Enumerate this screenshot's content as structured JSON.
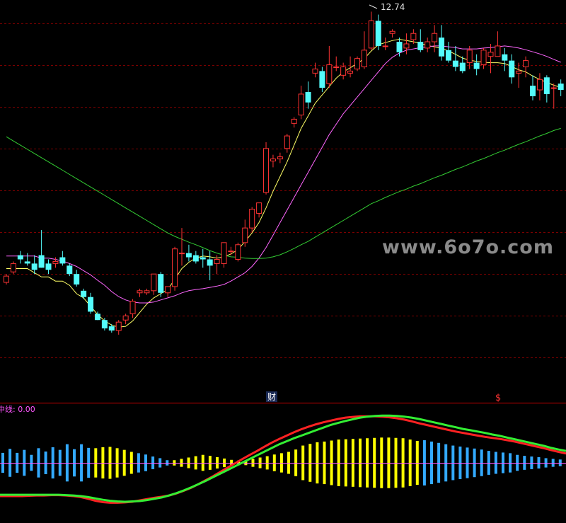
{
  "chart_data": [
    {
      "type": "candlestick",
      "panel": "price",
      "ylim": [
        4.9,
        12.9
      ],
      "max_label": "12.74",
      "ohlc": [
        [
          6.27,
          6.47,
          6.22,
          6.42
        ],
        [
          6.52,
          6.77,
          6.47,
          6.72
        ],
        [
          6.92,
          7.02,
          6.72,
          6.82
        ],
        [
          6.77,
          6.97,
          6.67,
          6.72
        ],
        [
          6.72,
          6.92,
          6.47,
          6.57
        ],
        [
          6.92,
          7.52,
          6.62,
          6.62
        ],
        [
          6.72,
          6.82,
          6.47,
          6.57
        ],
        [
          6.72,
          6.87,
          6.62,
          6.77
        ],
        [
          6.87,
          7.02,
          6.67,
          6.72
        ],
        [
          6.67,
          6.72,
          6.42,
          6.47
        ],
        [
          6.47,
          6.57,
          6.17,
          6.22
        ],
        [
          6.07,
          6.12,
          5.87,
          5.92
        ],
        [
          5.92,
          6.02,
          5.52,
          5.57
        ],
        [
          5.52,
          5.57,
          5.37,
          5.37
        ],
        [
          5.37,
          5.42,
          5.12,
          5.17
        ],
        [
          5.22,
          5.27,
          5.07,
          5.12
        ],
        [
          5.12,
          5.37,
          5.02,
          5.32
        ],
        [
          5.37,
          5.52,
          5.27,
          5.47
        ],
        [
          5.52,
          5.87,
          5.42,
          5.82
        ],
        [
          6.02,
          6.12,
          5.92,
          6.07
        ],
        [
          6.02,
          6.12,
          5.97,
          6.07
        ],
        [
          6.07,
          6.47,
          5.97,
          6.47
        ],
        [
          6.47,
          6.52,
          5.92,
          6.02
        ],
        [
          6.02,
          6.17,
          5.92,
          6.17
        ],
        [
          6.17,
          7.12,
          6.07,
          7.07
        ],
        [
          6.97,
          7.57,
          6.67,
          6.97
        ],
        [
          6.97,
          7.17,
          6.77,
          6.87
        ],
        [
          6.92,
          7.02,
          6.72,
          6.77
        ],
        [
          6.87,
          7.07,
          6.62,
          6.82
        ],
        [
          6.82,
          7.02,
          6.32,
          6.67
        ],
        [
          6.72,
          6.92,
          6.47,
          6.82
        ],
        [
          6.72,
          7.22,
          6.62,
          7.22
        ],
        [
          7.02,
          7.12,
          6.92,
          7.02
        ],
        [
          6.82,
          7.22,
          6.77,
          7.17
        ],
        [
          7.22,
          7.77,
          7.12,
          7.57
        ],
        [
          7.57,
          8.07,
          7.47,
          8.02
        ],
        [
          7.92,
          8.17,
          7.82,
          8.17
        ],
        [
          8.42,
          9.62,
          8.37,
          9.47
        ],
        [
          9.17,
          9.32,
          9.02,
          9.22
        ],
        [
          9.22,
          9.37,
          9.12,
          9.27
        ],
        [
          9.47,
          9.82,
          9.37,
          9.77
        ],
        [
          10.07,
          10.22,
          9.97,
          10.17
        ],
        [
          10.27,
          10.97,
          10.17,
          10.77
        ],
        [
          10.82,
          11.07,
          10.42,
          10.57
        ],
        [
          11.27,
          11.52,
          11.17,
          11.37
        ],
        [
          11.32,
          11.42,
          10.82,
          10.92
        ],
        [
          11.02,
          11.92,
          10.92,
          11.47
        ],
        [
          11.42,
          11.67,
          11.32,
          11.42
        ],
        [
          11.22,
          11.52,
          11.12,
          11.42
        ],
        [
          11.27,
          11.67,
          11.17,
          11.32
        ],
        [
          11.37,
          11.67,
          11.32,
          11.62
        ],
        [
          11.42,
          12.27,
          11.37,
          11.82
        ],
        [
          11.87,
          12.74,
          11.82,
          12.52
        ],
        [
          12.52,
          12.67,
          11.82,
          11.92
        ],
        [
          11.92,
          12.12,
          11.82,
          11.92
        ],
        [
          12.22,
          12.32,
          12.12,
          12.27
        ],
        [
          12.02,
          12.12,
          11.67,
          11.77
        ],
        [
          11.87,
          12.22,
          11.72,
          11.97
        ],
        [
          12.07,
          12.32,
          11.97,
          12.22
        ],
        [
          12.02,
          12.32,
          11.77,
          11.82
        ],
        [
          11.87,
          12.12,
          11.77,
          12.02
        ],
        [
          12.02,
          12.42,
          11.77,
          12.22
        ],
        [
          12.12,
          12.42,
          11.57,
          11.67
        ],
        [
          11.82,
          12.02,
          11.52,
          11.57
        ],
        [
          11.57,
          11.92,
          11.32,
          11.42
        ],
        [
          11.52,
          11.67,
          11.27,
          11.32
        ],
        [
          11.52,
          11.92,
          11.37,
          11.82
        ],
        [
          11.52,
          11.72,
          11.22,
          11.37
        ],
        [
          11.47,
          11.87,
          11.37,
          11.82
        ],
        [
          11.67,
          11.97,
          11.27,
          11.77
        ],
        [
          11.67,
          12.27,
          11.67,
          11.92
        ],
        [
          11.72,
          11.87,
          11.32,
          11.57
        ],
        [
          11.57,
          11.72,
          11.02,
          11.17
        ],
        [
          11.27,
          11.52,
          10.92,
          11.32
        ],
        [
          11.42,
          11.67,
          11.17,
          11.57
        ],
        [
          10.97,
          11.22,
          10.62,
          10.72
        ],
        [
          10.87,
          11.27,
          10.62,
          11.12
        ],
        [
          11.17,
          11.22,
          10.57,
          10.77
        ],
        [
          10.92,
          11.02,
          10.42,
          10.92
        ],
        [
          11.02,
          11.12,
          10.72,
          10.87
        ]
      ],
      "moving_averages": [
        {
          "color": "#ffff66",
          "values": [
            6.6,
            6.6,
            6.6,
            6.6,
            6.5,
            6.4,
            6.4,
            6.3,
            6.3,
            6.2,
            6.0,
            5.9,
            5.7,
            5.5,
            5.35,
            5.25,
            5.2,
            5.22,
            5.35,
            5.55,
            5.75,
            5.9,
            6.0,
            6.1,
            6.35,
            6.6,
            6.75,
            6.85,
            6.9,
            6.88,
            6.85,
            6.88,
            6.95,
            7.05,
            7.25,
            7.45,
            7.7,
            8.05,
            8.45,
            8.8,
            9.15,
            9.55,
            9.95,
            10.25,
            10.55,
            10.75,
            10.95,
            11.15,
            11.3,
            11.4,
            11.5,
            11.62,
            11.8,
            11.95,
            12.0,
            12.05,
            12.08,
            12.05,
            12.02,
            11.98,
            11.93,
            11.9,
            11.86,
            11.8,
            11.72,
            11.63,
            11.58,
            11.55,
            11.53,
            11.52,
            11.52,
            11.5,
            11.43,
            11.35,
            11.3,
            11.2,
            11.12,
            11.05,
            10.98,
            10.93
          ]
        },
        {
          "color": "#ff66ff",
          "values": [
            6.9,
            6.9,
            6.9,
            6.9,
            6.9,
            6.85,
            6.85,
            6.82,
            6.78,
            6.72,
            6.65,
            6.55,
            6.45,
            6.32,
            6.2,
            6.05,
            5.93,
            5.85,
            5.8,
            5.78,
            5.78,
            5.8,
            5.85,
            5.9,
            5.95,
            6.02,
            6.07,
            6.1,
            6.12,
            6.15,
            6.18,
            6.22,
            6.3,
            6.4,
            6.5,
            6.65,
            6.85,
            7.1,
            7.4,
            7.7,
            8.0,
            8.3,
            8.6,
            8.9,
            9.2,
            9.5,
            9.8,
            10.05,
            10.3,
            10.5,
            10.7,
            10.9,
            11.1,
            11.3,
            11.5,
            11.65,
            11.75,
            11.82,
            11.85,
            11.88,
            11.9,
            11.92,
            11.92,
            11.9,
            11.88,
            11.85,
            11.85,
            11.85,
            11.87,
            11.88,
            11.9,
            11.92,
            11.9,
            11.87,
            11.83,
            11.78,
            11.73,
            11.67,
            11.6,
            11.53
          ]
        },
        {
          "color": "#33cc33",
          "values": [
            9.75,
            9.65,
            9.55,
            9.45,
            9.35,
            9.25,
            9.15,
            9.05,
            8.95,
            8.85,
            8.75,
            8.65,
            8.55,
            8.45,
            8.35,
            8.25,
            8.15,
            8.05,
            7.95,
            7.85,
            7.75,
            7.65,
            7.55,
            7.45,
            7.37,
            7.3,
            7.23,
            7.17,
            7.1,
            7.03,
            6.97,
            6.92,
            6.88,
            6.87,
            6.85,
            6.84,
            6.84,
            6.85,
            6.88,
            6.93,
            7.0,
            7.08,
            7.17,
            7.25,
            7.35,
            7.45,
            7.55,
            7.65,
            7.75,
            7.85,
            7.95,
            8.05,
            8.15,
            8.22,
            8.3,
            8.37,
            8.44,
            8.5,
            8.57,
            8.63,
            8.7,
            8.77,
            8.83,
            8.9,
            8.97,
            9.03,
            9.1,
            9.17,
            9.23,
            9.3,
            9.37,
            9.43,
            9.5,
            9.57,
            9.63,
            9.7,
            9.77,
            9.83,
            9.9,
            9.95
          ]
        }
      ],
      "annotations": [
        "财",
        "$"
      ]
    },
    {
      "type": "bar",
      "panel": "indicator",
      "label": "中线: 0.00",
      "label_color": "#ff55ff",
      "ylim": [
        -1.3,
        1.3
      ],
      "colors": {
        "positive": "#ffff00",
        "negative": "#33aaff"
      },
      "values": [
        -0.3,
        -0.42,
        -0.3,
        -0.39,
        -0.24,
        -0.44,
        -0.34,
        -0.47,
        -0.39,
        -0.56,
        -0.41,
        -0.56,
        -0.45,
        0.44,
        0.47,
        0.48,
        0.44,
        0.39,
        0.33,
        -0.29,
        -0.25,
        -0.19,
        -0.14,
        -0.08,
        0.08,
        0.12,
        0.16,
        0.2,
        0.24,
        0.21,
        0.17,
        0.13,
        0.09,
        0.07,
        0.07,
        0.12,
        0.16,
        0.2,
        0.25,
        0.29,
        0.33,
        0.4,
        0.52,
        0.57,
        0.62,
        0.64,
        0.67,
        0.7,
        0.71,
        0.72,
        0.73,
        0.74,
        0.75,
        0.76,
        0.76,
        0.75,
        0.74,
        0.7,
        0.66,
        -0.68,
        -0.64,
        -0.6,
        -0.56,
        -0.52,
        -0.49,
        -0.46,
        -0.43,
        -0.4,
        -0.36,
        -0.33,
        -0.31,
        -0.29,
        -0.24,
        -0.21,
        -0.19,
        -0.17,
        -0.14,
        -0.12,
        -0.1
      ],
      "lines": [
        {
          "color": "#ff2222",
          "values": [
            -1.0,
            -1.0,
            -1.0,
            -1.0,
            -0.99,
            -0.98,
            -0.98,
            -0.97,
            -0.97,
            -0.98,
            -1.0,
            -1.03,
            -1.08,
            -1.14,
            -1.18,
            -1.2,
            -1.2,
            -1.19,
            -1.17,
            -1.13,
            -1.09,
            -1.05,
            -1.02,
            -0.98,
            -0.92,
            -0.84,
            -0.75,
            -0.64,
            -0.52,
            -0.4,
            -0.27,
            -0.14,
            -0.01,
            0.12,
            0.24,
            0.36,
            0.49,
            0.61,
            0.72,
            0.82,
            0.92,
            1.01,
            1.09,
            1.16,
            1.22,
            1.27,
            1.32,
            1.36,
            1.38,
            1.4,
            1.4,
            1.4,
            1.39,
            1.37,
            1.34,
            1.3,
            1.25,
            1.19,
            1.14,
            1.09,
            1.04,
            0.99,
            0.94,
            0.9,
            0.86,
            0.82,
            0.78,
            0.75,
            0.72,
            0.68,
            0.64,
            0.59,
            0.54,
            0.49,
            0.44,
            0.38,
            0.33,
            0.28
          ]
        },
        {
          "color": "#33ee33",
          "values": [
            -0.96,
            -0.96,
            -0.96,
            -0.96,
            -0.96,
            -0.96,
            -0.96,
            -0.96,
            -0.96,
            -0.97,
            -0.98,
            -1.0,
            -1.03,
            -1.07,
            -1.11,
            -1.14,
            -1.16,
            -1.17,
            -1.16,
            -1.15,
            -1.12,
            -1.08,
            -1.04,
            -0.98,
            -0.91,
            -0.83,
            -0.74,
            -0.64,
            -0.54,
            -0.43,
            -0.32,
            -0.21,
            -0.1,
            0.01,
            0.12,
            0.23,
            0.34,
            0.45,
            0.56,
            0.65,
            0.74,
            0.82,
            0.9,
            0.98,
            1.06,
            1.14,
            1.2,
            1.26,
            1.31,
            1.36,
            1.39,
            1.41,
            1.42,
            1.42,
            1.41,
            1.39,
            1.36,
            1.32,
            1.27,
            1.22,
            1.17,
            1.12,
            1.07,
            1.02,
            0.98,
            0.94,
            0.9,
            0.85,
            0.81,
            0.76,
            0.71,
            0.66,
            0.61,
            0.56,
            0.51,
            0.45,
            0.4,
            0.36
          ]
        }
      ]
    }
  ],
  "watermark": "www.6o7o.com"
}
